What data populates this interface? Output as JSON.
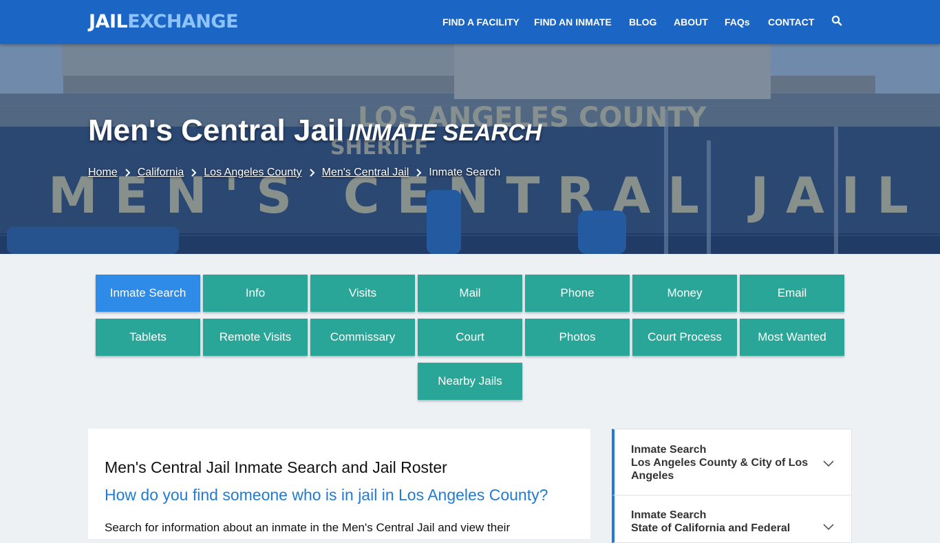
{
  "header": {
    "logo_part1": "JAIL",
    "logo_part2": "EXCHANGE",
    "nav": [
      "FIND A FACILITY",
      "FIND AN INMATE",
      "BLOG",
      "ABOUT",
      "FAQs",
      "CONTACT"
    ],
    "search_icon": "search-icon"
  },
  "hero": {
    "title": "Men's Central Jail",
    "subtitle": "INMATE SEARCH",
    "breadcrumb": [
      "Home",
      "California",
      "Los Angeles County",
      "Men's Central Jail"
    ],
    "breadcrumb_current": "Inmate Search"
  },
  "buttons": {
    "row1": [
      "Inmate Search",
      "Info",
      "Visits",
      "Mail",
      "Phone",
      "Money",
      "Email"
    ],
    "row2": [
      "Tablets",
      "Remote Visits",
      "Commissary",
      "Court",
      "Photos",
      "Court Process",
      "Most Wanted"
    ],
    "row3": [
      "Nearby Jails"
    ],
    "active": "Inmate Search"
  },
  "main": {
    "heading": "Men's Central Jail Inmate Search and Jail Roster",
    "question": "How do you find someone who is in jail in Los Angeles County?",
    "paragraph": "Search for information about an inmate in the Men's Central Jail and view their"
  },
  "sidebar": {
    "items": [
      {
        "title": "Inmate Search",
        "subtitle": "Los Angeles County & City of Los Angeles"
      },
      {
        "title": "Inmate Search",
        "subtitle": "State of California and Federal"
      }
    ]
  },
  "colors": {
    "brand_blue": "#1b66c4",
    "teal_button": "#2aa698",
    "active_button": "#2f8be8",
    "link_blue": "#1f7bd4"
  }
}
